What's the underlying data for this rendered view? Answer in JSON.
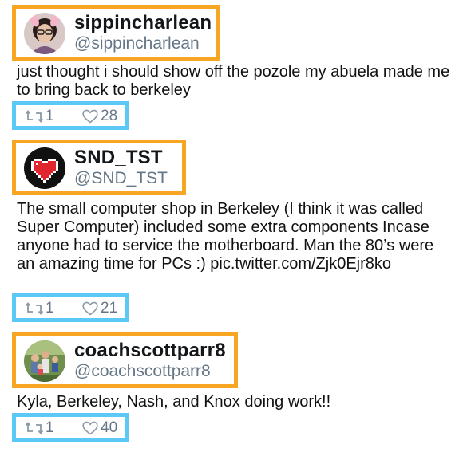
{
  "tweets": [
    {
      "display_name": "sippincharlean",
      "handle": "@sippincharlean",
      "text": "just thought i should show off the pozole my abuela made me to bring back to berkeley",
      "retweets": "1",
      "likes": "28",
      "avatar_icon": "woman-with-bunny-ears-photo"
    },
    {
      "display_name": "SND_TST",
      "handle": "@SND_TST",
      "text": "The small computer shop in Berkeley (I think it was called Super Computer) included some extra components Incase anyone had to service the motherboard. Man the 80’s were an amazing time for PCs :) pic.twitter.com/Zjk0Ejr8ko",
      "retweets": "1",
      "likes": "21",
      "avatar_icon": "pixel-heart-icon"
    },
    {
      "display_name": "coachscottparr8",
      "handle": "@coachscottparr8",
      "text": "Kyla, Berkeley, Nash, and Knox doing work!!",
      "retweets": "1",
      "likes": "40",
      "avatar_icon": "family-group-photo"
    }
  ],
  "colors": {
    "author_highlight": "#f6a623",
    "actions_highlight": "#5bc8f5",
    "handle_gray": "#657786"
  },
  "icons": {
    "retweet": "retweet-icon",
    "like": "heart-outline-icon"
  }
}
